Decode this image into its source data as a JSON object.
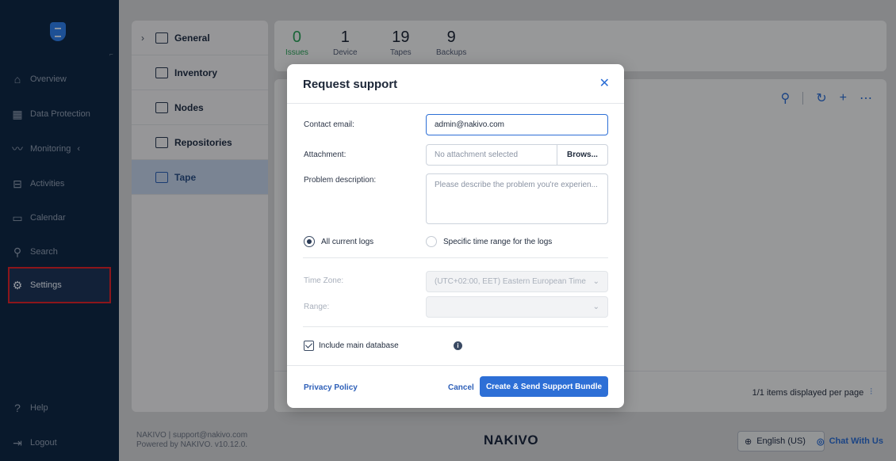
{
  "nav": {
    "items": [
      {
        "label": "Overview",
        "icon": "home-icon"
      },
      {
        "label": "Data Protection",
        "icon": "grid-icon"
      },
      {
        "label": "Monitoring",
        "icon": "chart-line-icon"
      },
      {
        "label": "Activities",
        "icon": "inbox-icon"
      },
      {
        "label": "Calendar",
        "icon": "calendar-icon"
      },
      {
        "label": "Search",
        "icon": "search-icon"
      },
      {
        "label": "Settings",
        "icon": "gear-icon"
      },
      {
        "label": "Help",
        "icon": "help-icon"
      },
      {
        "label": "Logout",
        "icon": "logout-icon"
      }
    ]
  },
  "tree": {
    "items": [
      {
        "label": "General"
      },
      {
        "label": "Inventory"
      },
      {
        "label": "Nodes"
      },
      {
        "label": "Repositories"
      },
      {
        "label": "Tape"
      }
    ]
  },
  "stats": [
    {
      "num": "0",
      "label": "Issues"
    },
    {
      "num": "1",
      "label": "Device"
    },
    {
      "num": "19",
      "label": "Tapes"
    },
    {
      "num": "9",
      "label": "Backups"
    }
  ],
  "panel": {
    "items_info": "1/1 items displayed per page"
  },
  "footer": {
    "copy_line1": "NAKIVO | support@nakivo.com",
    "copy_line2": "Powered by NAKIVO. v10.12.0.",
    "brand": "NAKIVO",
    "language": "English (US)",
    "chat": "Chat With Us"
  },
  "modal": {
    "title": "Request support",
    "contact_label": "Contact email:",
    "contact_value": "admin@nakivo.com",
    "attachment_label": "Attachment:",
    "attachment_value": "No attachment selected",
    "browse_label": "Brows...",
    "problem_label": "Problem description:",
    "problem_placeholder": "Please describe the problem you're experien...",
    "radio_all": "All current logs",
    "radio_specific": "Specific time range for the logs",
    "timezone_label": "Time Zone:",
    "timezone_value": "(UTC+02:00, EET) Eastern European Time",
    "range_label": "Range:",
    "include_db": "Include main database",
    "privacy": "Privacy Policy",
    "cancel": "Cancel",
    "submit": "Create & Send Support Bundle"
  },
  "colors": {
    "accent": "#2d6fd6",
    "nav_bg": "#0e2744",
    "highlight": "#d8232a",
    "issues_green": "#29a35a"
  }
}
